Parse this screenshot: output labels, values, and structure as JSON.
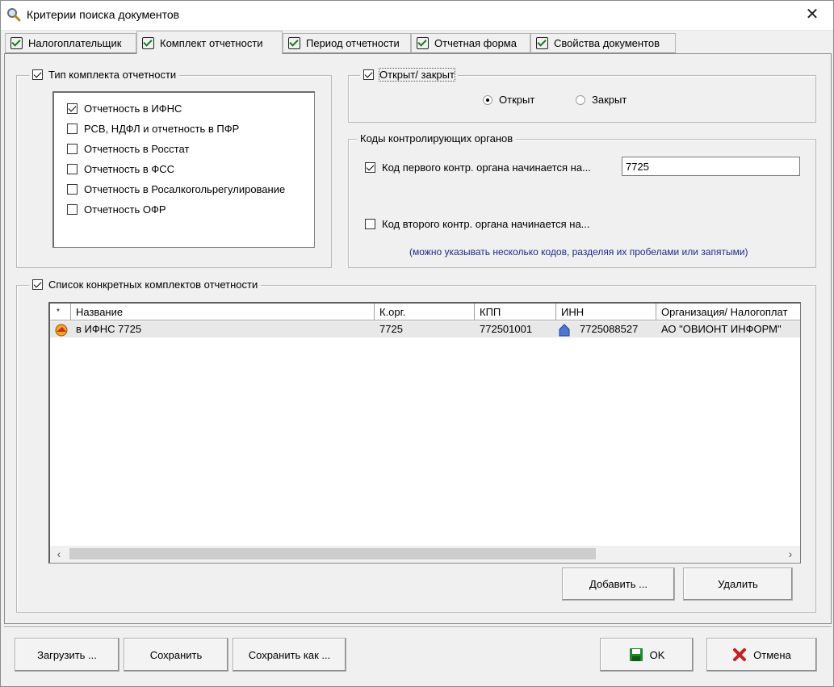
{
  "window": {
    "title": "Критерии поиска документов",
    "close_glyph": "✕"
  },
  "tabs": [
    {
      "label": "Налогоплательщик",
      "active": false
    },
    {
      "label": "Комплект отчетности",
      "active": true
    },
    {
      "label": "Период отчетности",
      "active": false
    },
    {
      "label": "Отчетная форма",
      "active": false
    },
    {
      "label": "Свойства документов",
      "active": false
    }
  ],
  "report_type": {
    "legend": "Тип комплекта отчетности",
    "legend_checked": true,
    "items": [
      {
        "label": "Отчетность в ИФНС",
        "checked": true
      },
      {
        "label": "РСВ, НДФЛ и отчетность в ПФР",
        "checked": false
      },
      {
        "label": "Отчетность в Росстат",
        "checked": false
      },
      {
        "label": "Отчетность в ФСС",
        "checked": false
      },
      {
        "label": "Отчетность в Росалкогольрегулирование",
        "checked": false
      },
      {
        "label": "Отчетность ОФР",
        "checked": false
      }
    ]
  },
  "open_closed": {
    "legend": "Открыт/ закрыт",
    "legend_checked": true,
    "options": [
      {
        "label": "Открыт",
        "selected": true
      },
      {
        "label": "Закрыт",
        "selected": false
      }
    ]
  },
  "control_codes": {
    "legend": "Коды контролирующих органов",
    "first": {
      "label": "Код первого контр. органа начинается на...",
      "checked": true,
      "value": "7725"
    },
    "second": {
      "label": "Код второго контр. органа начинается на...",
      "checked": false,
      "value": ""
    },
    "hint": "(можно указывать несколько кодов, разделяя их пробелами или запятыми)"
  },
  "sets_list": {
    "legend": "Список конкретных комплектов отчетности",
    "legend_checked": true,
    "columns": [
      "*",
      "Название",
      "К.орг.",
      "КПП",
      "ИНН",
      "Организация/ Налогоплат"
    ],
    "rows": [
      {
        "name": "в ИФНС 7725",
        "korg": "7725",
        "kpp": "772501001",
        "inn": "7725088527",
        "org": "АО \"ОВИОНТ ИНФОРМ\""
      }
    ],
    "add_label": "Добавить ...",
    "delete_label": "Удалить"
  },
  "footer": {
    "load_label": "Загрузить ...",
    "save_label": "Сохранить",
    "save_as_label": "Сохранить как ...",
    "ok_label": "OK",
    "cancel_label": "Отмена"
  },
  "colors": {
    "hint": "#1a2a8c",
    "ok_icon": "#1d8a2a",
    "cancel_icon": "#c81e1e",
    "tab_check": "#1a7a1a"
  }
}
